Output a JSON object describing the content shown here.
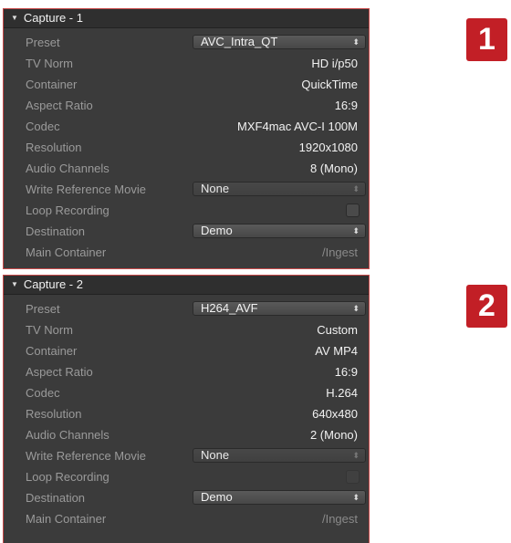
{
  "panels": [
    {
      "title": "Capture - 1",
      "rows": {
        "preset": {
          "label": "Preset",
          "value": "AVC_Intra_QT"
        },
        "tv_norm": {
          "label": "TV Norm",
          "value": "HD i/p50"
        },
        "container": {
          "label": "Container",
          "value": "QuickTime"
        },
        "aspect_ratio": {
          "label": "Aspect Ratio",
          "value": "16:9"
        },
        "codec": {
          "label": "Codec",
          "value": "MXF4mac AVC-I 100M"
        },
        "resolution": {
          "label": "Resolution",
          "value": "1920x1080"
        },
        "audio_channels": {
          "label": "Audio Channels",
          "value": "8 (Mono)"
        },
        "write_reference_movie": {
          "label": "Write Reference Movie",
          "value": "None"
        },
        "loop_recording": {
          "label": "Loop Recording",
          "checked": false
        },
        "destination": {
          "label": "Destination",
          "value": "Demo"
        },
        "main_container": {
          "label": "Main Container",
          "value": "/Ingest"
        }
      }
    },
    {
      "title": "Capture - 2",
      "rows": {
        "preset": {
          "label": "Preset",
          "value": "H264_AVF"
        },
        "tv_norm": {
          "label": "TV Norm",
          "value": "Custom"
        },
        "container": {
          "label": "Container",
          "value": "AV MP4"
        },
        "aspect_ratio": {
          "label": "Aspect Ratio",
          "value": "16:9"
        },
        "codec": {
          "label": "Codec",
          "value": "H.264"
        },
        "resolution": {
          "label": "Resolution",
          "value": "640x480"
        },
        "audio_channels": {
          "label": "Audio Channels",
          "value": "2 (Mono)"
        },
        "write_reference_movie": {
          "label": "Write Reference Movie",
          "value": "None"
        },
        "loop_recording": {
          "label": "Loop Recording",
          "checked": false
        },
        "destination": {
          "label": "Destination",
          "value": "Demo"
        },
        "main_container": {
          "label": "Main Container",
          "value": "/Ingest"
        }
      }
    }
  ],
  "badges": [
    "1",
    "2"
  ],
  "icons": {
    "disclosure": "disclosure-triangle-icon",
    "popup_arrows": "updown-arrows-icon"
  },
  "colors": {
    "panel_bg": "#3b3b3b",
    "badge": "#c21f26",
    "panel_border": "#c84a4a"
  }
}
